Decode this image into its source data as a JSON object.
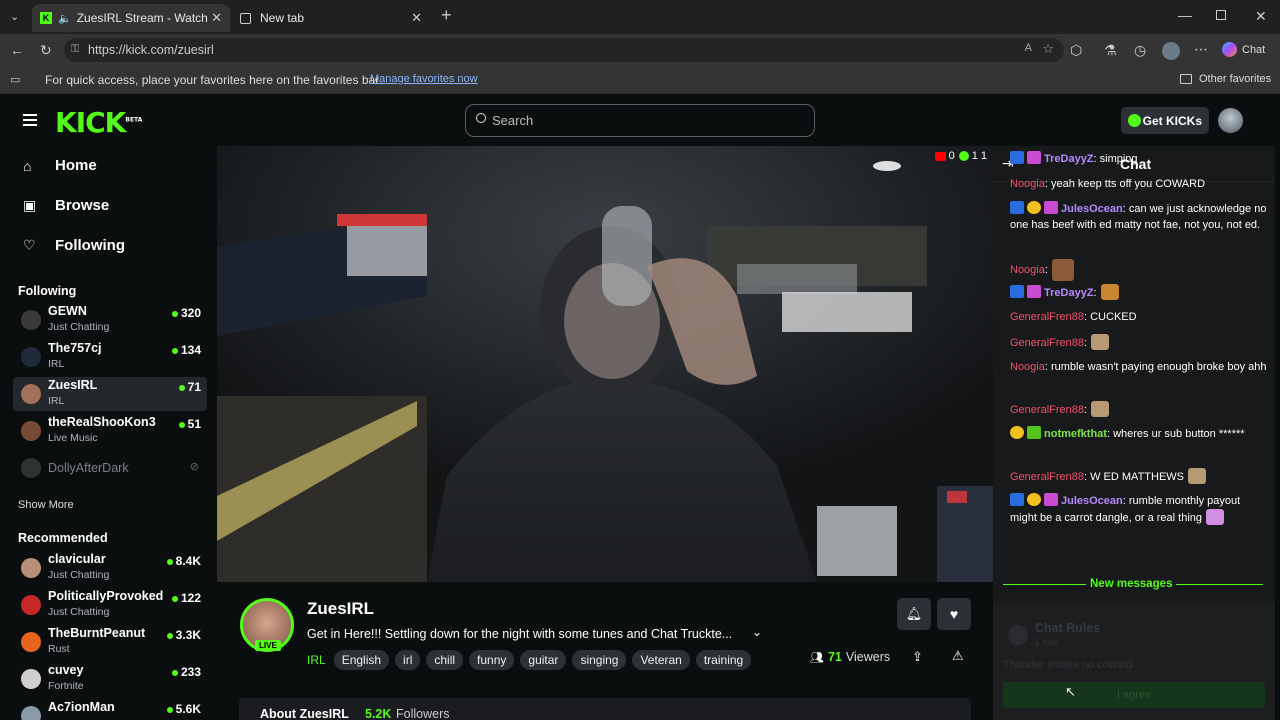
{
  "browser": {
    "tabs": [
      {
        "title": "ZuesIRL Stream - Watch Live o",
        "active": true
      },
      {
        "title": "New tab",
        "active": false
      }
    ],
    "url": "https://kick.com/zuesirl",
    "copilot_label": "Chat",
    "favorites_prompt": "For quick access, place your favorites here on the favorites bar.",
    "favorites_link": "Manage favorites now",
    "other_favorites": "Other favorites"
  },
  "kick": {
    "logo": "KICK",
    "logo_beta": "BETA",
    "search_placeholder": "Search",
    "get_kicks": "Get KICKs"
  },
  "sidebar": {
    "nav": [
      {
        "label": "Home",
        "icon": "home-icon"
      },
      {
        "label": "Browse",
        "icon": "browse-icon"
      },
      {
        "label": "Following",
        "icon": "heart-icon"
      }
    ],
    "following_title": "Following",
    "following": [
      {
        "name": "GEWN",
        "category": "Just Chatting",
        "viewers": "320",
        "color": "#3a3a3a"
      },
      {
        "name": "The757cj",
        "category": "IRL",
        "viewers": "134",
        "color": "#1f2b3a"
      },
      {
        "name": "ZuesIRL",
        "category": "IRL",
        "viewers": "71",
        "color": "#a3705a",
        "selected": true
      },
      {
        "name": "theRealShooKon3",
        "category": "Live Music",
        "viewers": "51",
        "color": "#7a4a38"
      },
      {
        "name": "DollyAfterDark",
        "category": "",
        "viewers": "",
        "color": "#555",
        "offline": true
      }
    ],
    "show_more": "Show More",
    "recommended_title": "Recommended",
    "recommended": [
      {
        "name": "clavicular",
        "category": "Just Chatting",
        "viewers": "8.4K",
        "color": "#b89078"
      },
      {
        "name": "PoliticallyProvoked",
        "category": "Just Chatting",
        "viewers": "122",
        "color": "#c62828"
      },
      {
        "name": "TheBurntPeanut",
        "category": "Rust",
        "viewers": "3.3K",
        "color": "#e8641c"
      },
      {
        "name": "cuvey",
        "category": "Fortnite",
        "viewers": "233",
        "color": "#cfcfcf"
      },
      {
        "name": "Ac7ionMan",
        "category": "",
        "viewers": "5.6K",
        "color": "#8a9aa8"
      }
    ]
  },
  "video": {
    "overlay_count_1": "0",
    "overlay_count_2": "1 1"
  },
  "stream": {
    "channel": "ZuesIRL",
    "live_badge": "LIVE",
    "title": "Get in Here!!! Settling down for the night with some tunes and Chat Truckte...",
    "category": "IRL",
    "tags": [
      "English",
      "irl",
      "chill",
      "funny",
      "guitar",
      "singing",
      "Veteran",
      "training"
    ],
    "viewers_count": "71",
    "viewers_label": "Viewers",
    "about_label": "About ZuesIRL",
    "followers_count": "5.2K",
    "followers_label": "Followers"
  },
  "chat": {
    "title": "Chat",
    "new_messages": "New messages",
    "rules_title": "Chat Rules",
    "rules_sub": "1 rule",
    "rules_text": "Thunder smites no coward",
    "agree": "I agree",
    "messages": [
      {
        "user": "TreDayyZ",
        "text": ": simping"
      },
      {
        "user": "Noogia",
        "text": ": yeah keep tts off you COWARD"
      },
      {
        "user": "JulesOcean",
        "text": ": can we just acknowledge no one has beef with ed matty not fae, not you, not ed."
      },
      {
        "user": "Noogia",
        "text": ":"
      },
      {
        "user": "TreDayyZ",
        "text": ":"
      },
      {
        "user": "GeneralFren88",
        "text": ": CUCKED"
      },
      {
        "user": "GeneralFren88",
        "text": ":"
      },
      {
        "user": "Noogia",
        "text": ": rumble wasn't paying enough broke boy ahh"
      },
      {
        "user": "GeneralFren88",
        "text": ":"
      },
      {
        "user": "notmefkthat",
        "text": ": wheres ur sub button ******"
      },
      {
        "user": "GeneralFren88",
        "text": ": W ED MATTHEWS"
      },
      {
        "user": "JulesOcean",
        "text": ": rumble monthly payout might be a carrot dangle, or a real thing"
      }
    ]
  },
  "colors": {
    "kick_green": "#53fc18",
    "chat_bg": "#18191b",
    "page_bg": "#0b0e0f"
  }
}
